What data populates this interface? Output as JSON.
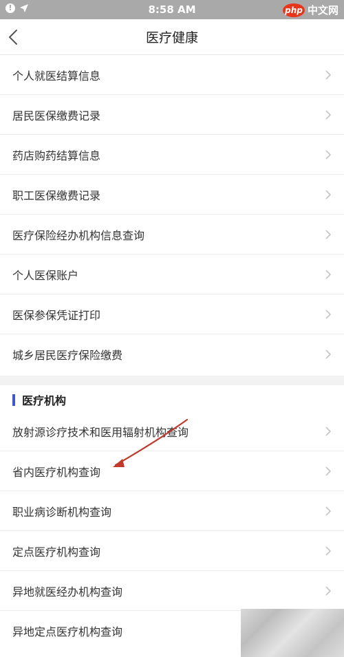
{
  "status": {
    "time": "8:58 AM",
    "watermark_logo": "php",
    "watermark_text": "中文网"
  },
  "nav": {
    "title": "医疗健康"
  },
  "list_items": [
    {
      "label": "个人就医结算信息"
    },
    {
      "label": "居民医保缴费记录"
    },
    {
      "label": "药店购药结算信息"
    },
    {
      "label": "职工医保缴费记录"
    },
    {
      "label": "医疗保险经办机构信息查询"
    },
    {
      "label": "个人医保账户"
    },
    {
      "label": "医保参保凭证打印"
    },
    {
      "label": "城乡居民医疗保险缴费"
    }
  ],
  "section": {
    "title": "医疗机构",
    "accent_color": "#3f59c9",
    "items": [
      {
        "label": "放射源诊疗技术和医用辐射机构查询"
      },
      {
        "label": "省内医疗机构查询"
      },
      {
        "label": "职业病诊断机构查询"
      },
      {
        "label": "定点医疗机构查询"
      },
      {
        "label": "异地就医经办机构查询"
      },
      {
        "label": "异地定点医疗机构查询"
      }
    ]
  },
  "annotation": {
    "type": "arrow",
    "color": "#c0392b",
    "points_to": "省内医疗机构查询"
  }
}
